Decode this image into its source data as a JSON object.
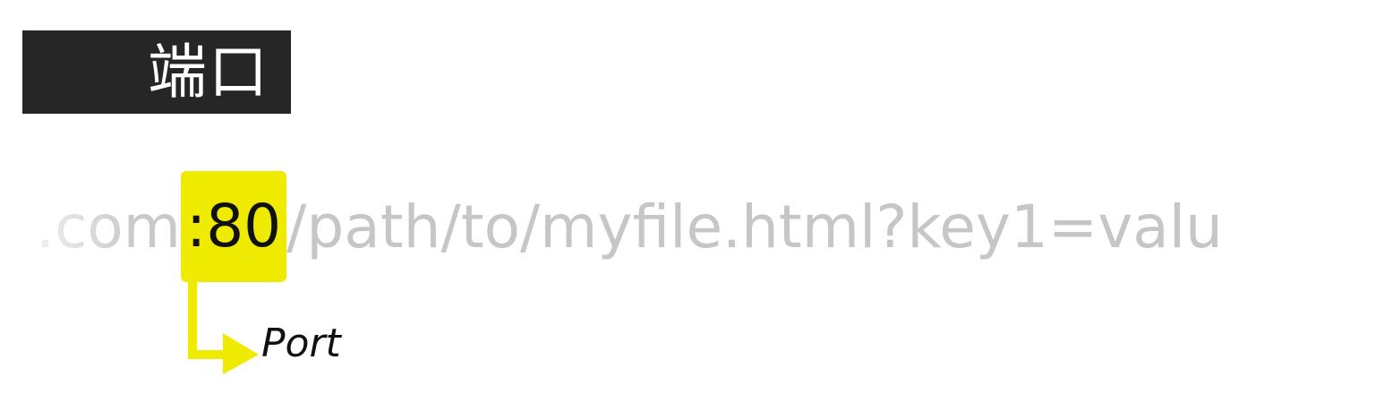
{
  "title": "端口",
  "url": {
    "before": ".com",
    "highlight": ":80",
    "after": "/path/to/myfile.html?key1=valu"
  },
  "annotation": {
    "label": "Port"
  },
  "colors": {
    "title_bg": "#262626",
    "title_text": "#ffffff",
    "highlight": "#eeea00",
    "url_muted": "#c6c6c6",
    "label_text": "#111111"
  }
}
